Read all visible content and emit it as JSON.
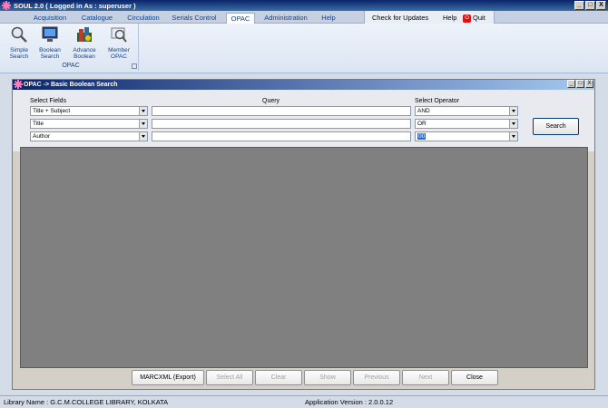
{
  "window": {
    "title": "SOUL 2.0  ( Logged in As : superuser )",
    "min_glyph": "_",
    "max_glyph": "□",
    "close_glyph": "X"
  },
  "ribbon_tabs": [
    "Acquisition",
    "Catalogue",
    "Circulation",
    "Serials Control",
    "OPAC",
    "Administration",
    "Help"
  ],
  "active_tab": "OPAC",
  "right_controls": {
    "updates": "Check for Updates",
    "help": "Help",
    "quit": "Quit"
  },
  "ribbon": {
    "group_label": "OPAC",
    "buttons": [
      {
        "label1": "Simple",
        "label2": "Search",
        "icon": "magnifier-icon"
      },
      {
        "label1": "Boolean",
        "label2": "Search",
        "icon": "monitor-icon"
      },
      {
        "label1": "Advance",
        "label2": "Boolean",
        "icon": "books-icon"
      },
      {
        "label1": "Member",
        "label2": "OPAC",
        "icon": "member-search-icon"
      }
    ]
  },
  "inner_window": {
    "title": "OPAC -> Basic Boolean Search",
    "min_glyph": "_",
    "max_glyph": "□",
    "close_glyph": "X"
  },
  "form": {
    "select_fields_header": "Select Fields",
    "query_header": "Query",
    "operator_header": "Select Operator",
    "rows": [
      {
        "field": "Title + Subject",
        "query": "",
        "operator": "AND"
      },
      {
        "field": "Title",
        "query": "",
        "operator": "OR"
      },
      {
        "field": "Author",
        "query": "",
        "operator": "00"
      }
    ],
    "search_label": "Search"
  },
  "bottom_buttons": [
    {
      "label": "MARCXML (Export)",
      "enabled": true
    },
    {
      "label": "Select All",
      "enabled": false
    },
    {
      "label": "Clear",
      "enabled": false
    },
    {
      "label": "Show",
      "enabled": false
    },
    {
      "label": "Previous",
      "enabled": false
    },
    {
      "label": "Next",
      "enabled": false
    },
    {
      "label": "Close",
      "enabled": true
    }
  ],
  "status": {
    "library": "Library Name : G.C.M.COLLEGE LIBRARY, KOLKATA",
    "version": "Application Version : 2.0.0.12"
  },
  "colors": {
    "titlebar": "#0a246a",
    "ribbon_text": "#15428b",
    "results_bg": "#808080",
    "quit_red": "#dd1111"
  }
}
